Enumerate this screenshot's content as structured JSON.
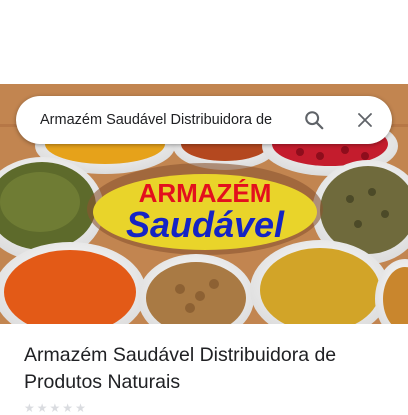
{
  "search": {
    "query": "Armazém Saudável Distribuidora de"
  },
  "hero_logo": {
    "line1": "ARMAZÉM",
    "line2": "Saudável",
    "colors": {
      "line1": "#e3101d",
      "line2": "#1524c4",
      "badge": "#e9d42a"
    }
  },
  "place": {
    "title": "Armazém Saudável Distribuidora de Produtos Naturais",
    "rating_stars": 0
  },
  "icons": {
    "search": "search-icon",
    "clear": "close-icon",
    "star": "star-icon"
  }
}
